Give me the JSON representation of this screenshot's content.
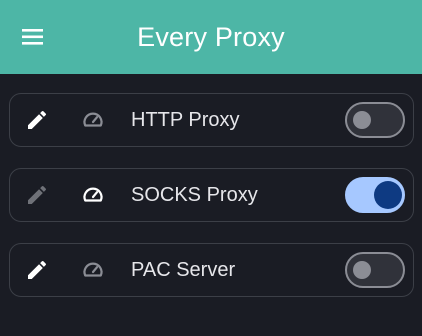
{
  "appbar": {
    "title": "Every Proxy",
    "menu_icon": "hamburger-menu-icon",
    "background": "#4db6a6"
  },
  "proxies": [
    {
      "label": "HTTP Proxy",
      "edit_icon": "pencil-icon",
      "status_icon": "speedometer-icon",
      "enabled": false
    },
    {
      "label": "SOCKS Proxy",
      "edit_icon": "pencil-icon",
      "status_icon": "speedometer-icon",
      "enabled": true
    },
    {
      "label": "PAC Server",
      "edit_icon": "pencil-icon",
      "status_icon": "speedometer-icon",
      "enabled": false
    }
  ],
  "colors": {
    "background": "#1a1c24",
    "card_border": "#3c3f47",
    "toggle_on_track": "#a6c8ff",
    "toggle_on_knob": "#0e3a82",
    "toggle_off": "#8b8d95"
  }
}
